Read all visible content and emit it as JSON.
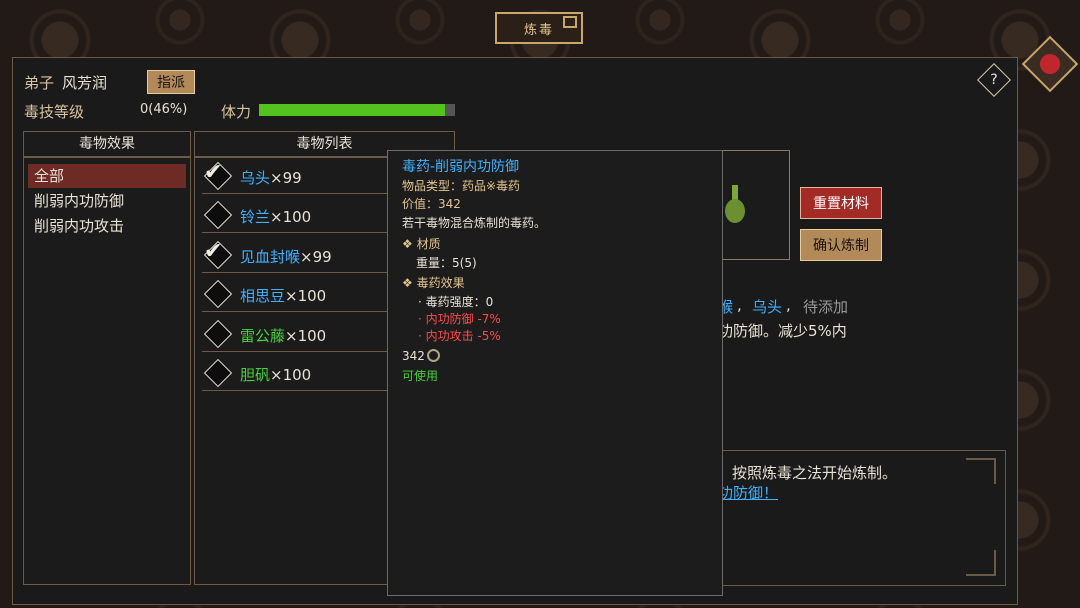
{
  "window": {
    "title": "炼毒"
  },
  "header": {
    "disciple_label": "弟子",
    "disciple_name": "风芳润",
    "assign_label": "指派",
    "skill_label": "毒技等级",
    "skill_value": "0(46%)",
    "stamina_label": "体力",
    "stamina_fraction": 0.95,
    "help_icon": "?"
  },
  "effects_panel": {
    "title": "毒物效果",
    "items": [
      "全部",
      "削弱内功防御",
      "削弱内功攻击"
    ],
    "selected_index": 0
  },
  "poison_list": {
    "title": "毒物列表",
    "items": [
      {
        "name": "乌头",
        "qty": "×99",
        "checked": true,
        "color": "#3fb1ff"
      },
      {
        "name": "铃兰",
        "qty": "×100",
        "checked": false,
        "color": "#3fb1ff"
      },
      {
        "name": "见血封喉",
        "qty": "×99",
        "checked": true,
        "color": "#3fb1ff"
      },
      {
        "name": "相思豆",
        "qty": "×100",
        "checked": false,
        "color": "#3fb1ff"
      },
      {
        "name": "雷公藤",
        "qty": "×100",
        "checked": false,
        "color": "#46d23a"
      },
      {
        "name": "胆矾",
        "qty": "×100",
        "checked": false,
        "color": "#46d23a"
      }
    ]
  },
  "tooltip": {
    "title": "毒药-削弱内功防御",
    "type": "物品类型：药品※毒药",
    "value": "价值：342",
    "desc": "若干毒物混合炼制的毒药。",
    "material_head": "❖ 材质",
    "weight": "重量：5(5)",
    "effect_head": "❖ 毒药效果",
    "strength": "· 毒药强度：0",
    "effect1": "· 内功防御 -7%",
    "effect2": "· 内功攻击 -5%",
    "price": "342",
    "usable": "可使用"
  },
  "actions": {
    "reset_label": "重置材料",
    "confirm_label": "确认炼制"
  },
  "recipe": {
    "frag1": "喉",
    "frag2": "乌头",
    "frag3": "待添加",
    "desc_frag": "功防御。减少5%内"
  },
  "message": {
    "line1": "按照炼毒之法开始炼制。",
    "line2": "功防御！"
  },
  "colors": {
    "accent_gold": "#c9a66b",
    "blue": "#3fb1ff",
    "green": "#46d23a",
    "red": "#ff4a4a"
  }
}
